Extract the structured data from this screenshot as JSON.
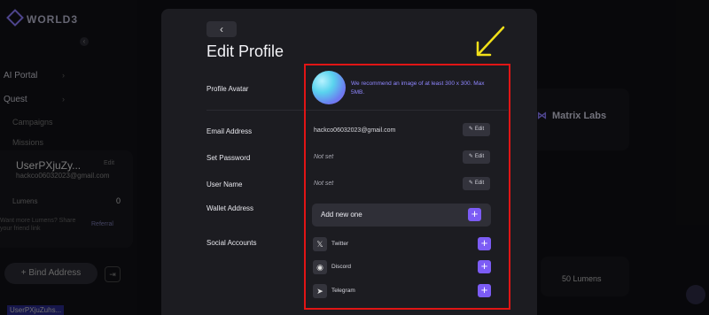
{
  "background": {
    "logo": "WORLD3",
    "nav": [
      {
        "label": "AI Portal"
      },
      {
        "label": "Quest"
      }
    ],
    "subnav": [
      {
        "label": "Campaigns"
      },
      {
        "label": "Missions"
      }
    ],
    "user_card": {
      "name": "UserPXjuZy...",
      "email": "hackco06032023@gmail.com",
      "edit": "Edit",
      "lumens_label": "Lumens",
      "lumens_value": "0",
      "hint": "Want more Lumens? Share your friend link",
      "refer": "Referral"
    },
    "bind_button": "+ Bind Address",
    "bottom_user": "UserPXjuZuhs...",
    "partner": "Matrix Labs",
    "lumens_card": "50 Lumens"
  },
  "modal": {
    "title": "Edit Profile",
    "back_icon": "‹",
    "avatar": {
      "label": "Profile Avatar",
      "recommend": "We recommend an image of at least 300 x 300. Max 5MB."
    },
    "email": {
      "label": "Email Address",
      "value": "hackco06032023@gmail.com",
      "edit": "Edit"
    },
    "password": {
      "label": "Set Password",
      "value": "Not set",
      "edit": "Edit"
    },
    "username": {
      "label": "User Name",
      "value": "Not set",
      "edit": "Edit"
    },
    "wallet": {
      "label": "Wallet Address",
      "add": "Add new one"
    },
    "social": {
      "label": "Social Accounts",
      "items": [
        {
          "name": "Twitter",
          "icon": "x-icon"
        },
        {
          "name": "Discord",
          "icon": "discord-icon"
        },
        {
          "name": "Telegram",
          "icon": "telegram-icon"
        }
      ]
    }
  },
  "colors": {
    "accent": "#7c5cf5",
    "highlight": "#e01515",
    "arrow": "#f2e019"
  }
}
